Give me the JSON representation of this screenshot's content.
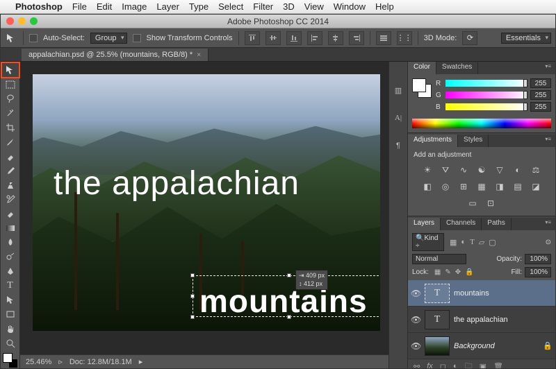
{
  "mac_menu": {
    "app": "Photoshop",
    "items": [
      "File",
      "Edit",
      "Image",
      "Layer",
      "Type",
      "Select",
      "Filter",
      "3D",
      "View",
      "Window",
      "Help"
    ]
  },
  "window_title": "Adobe Photoshop CC 2014",
  "options": {
    "auto_select": "Auto-Select:",
    "group": "Group",
    "show_transform": "Show Transform Controls",
    "mode_3d": "3D Mode:",
    "workspace": "Essentials"
  },
  "doc_tab": "appalachian.psd @ 25.5% (mountains, RGB/8) *",
  "canvas": {
    "text1": "the appalachian",
    "text2": "mountains",
    "measure_w": "⇥ 409 px",
    "measure_h": "↕ 412 px"
  },
  "status": {
    "zoom": "25.46%",
    "doc": "Doc: 12.8M/18.1M"
  },
  "color_panel": {
    "tabs": [
      "Color",
      "Swatches"
    ],
    "r": "255",
    "g": "255",
    "b": "255",
    "r_label": "R",
    "g_label": "G",
    "b_label": "B"
  },
  "adjustments_panel": {
    "tabs": [
      "Adjustments",
      "Styles"
    ],
    "heading": "Add an adjustment"
  },
  "layers_panel": {
    "tabs": [
      "Layers",
      "Channels",
      "Paths"
    ],
    "kind": "Kind",
    "blend": "Normal",
    "opacity_label": "Opacity:",
    "opacity": "100%",
    "lock_label": "Lock:",
    "fill_label": "Fill:",
    "fill": "100%",
    "layers": [
      {
        "name": "mountains",
        "type": "T",
        "active": true
      },
      {
        "name": "the appalachian",
        "type": "T",
        "active": false
      },
      {
        "name": "Background",
        "type": "img",
        "active": false,
        "locked": true,
        "italic": true
      }
    ]
  },
  "kind_placeholder": "🔍"
}
